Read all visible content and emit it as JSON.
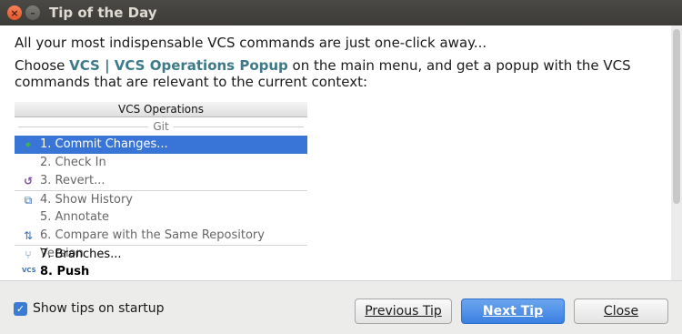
{
  "window": {
    "title": "Tip of the Day",
    "close_glyph": "×",
    "minimize_glyph": "–"
  },
  "tip": {
    "line1": "All your most indispensable VCS commands are just one-click away...",
    "line2_prefix": "Choose ",
    "line2_highlight": "VCS | VCS Operations Popup",
    "line2_suffix": " on the main menu, and get a popup with the VCS commands that are relevant to the current context:"
  },
  "popup": {
    "header": "VCS Operations",
    "group_label": "Git",
    "items": [
      {
        "label": "1. Commit Changes...",
        "icon": "commit-arrow-icon",
        "glyph": "◆"
      },
      {
        "label": "2. Check In",
        "icon": "",
        "glyph": ""
      },
      {
        "label": "3. Revert...",
        "icon": "revert-icon",
        "glyph": "↺"
      },
      {
        "label": "4. Show History",
        "icon": "history-icon",
        "glyph": "⧉"
      },
      {
        "label": "5. Annotate",
        "icon": "",
        "glyph": ""
      },
      {
        "label": "6. Compare with the Same Repository Version",
        "icon": "compare-icon",
        "glyph": "⇅"
      },
      {
        "label": "7. Branches...",
        "icon": "branches-icon",
        "glyph": "⑂"
      },
      {
        "label": "8. Push",
        "icon": "vcs-push-icon",
        "glyph": "VCS"
      }
    ]
  },
  "footer": {
    "checkbox_label": "Show tips on startup",
    "checkbox_checked": true,
    "checkbox_glyph": "✓",
    "previous_label": "Previous Tip",
    "next_label": "Next Tip",
    "close_label": "Close"
  },
  "colors": {
    "highlight_text": "#3c7a8a",
    "selected_row": "#3875d7",
    "primary_button": "#3b80e2",
    "titlebar": "#3c3b37"
  }
}
